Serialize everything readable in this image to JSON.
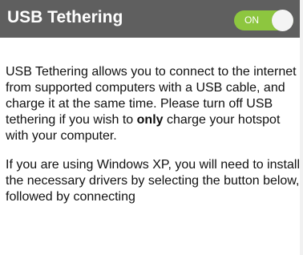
{
  "header": {
    "title": "USB Tethering",
    "toggle_label": "ON",
    "toggle_state": "on",
    "background_color": "#5f5f5f",
    "toggle_color": "#8dc63f"
  },
  "content": {
    "paragraph1": {
      "before_bold": "USB Tethering allows you to connect to the internet from supported computers with a USB cable, and charge it at the same time. Please turn off USB tethering if you wish to ",
      "bold": "only",
      "after_bold": " charge your hotspot with your computer."
    },
    "paragraph2": "If you are using Windows XP, you will need to install the necessary drivers by selecting the button below, followed by connecting"
  }
}
